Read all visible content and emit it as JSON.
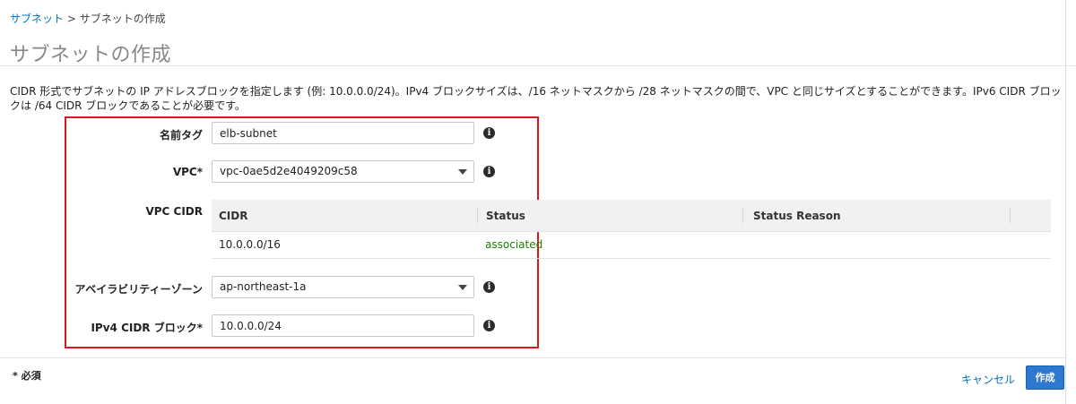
{
  "breadcrumb": {
    "parent": "サブネット",
    "separator": " > ",
    "current": "サブネットの作成"
  },
  "page_title": "サブネットの作成",
  "description": "CIDR 形式でサブネットの IP アドレスブロックを指定します (例: 10.0.0.0/24)。IPv4 ブロックサイズは、/16 ネットマスクから /28 ネットマスクの間で、VPC と同じサイズとすることができます。IPv6 CIDR ブロックは /64 CIDR ブロックであることが必要です。",
  "form": {
    "name_tag": {
      "label": "名前タグ",
      "value": "elb-subnet"
    },
    "vpc": {
      "label": "VPC*",
      "value": "vpc-0ae5d2e4049209c58"
    },
    "vpc_cidr": {
      "label": "VPC CIDR",
      "columns": [
        "CIDR",
        "Status",
        "Status Reason"
      ],
      "rows": [
        {
          "cidr": "10.0.0.0/16",
          "status": "associated",
          "reason": ""
        }
      ]
    },
    "availability_zone": {
      "label": "アベイラビリティーゾーン",
      "value": "ap-northeast-1a"
    },
    "ipv4_cidr": {
      "label": "IPv4 CIDR ブロック*",
      "value": "10.0.0.0/24"
    }
  },
  "footer": {
    "required_note": "* 必須",
    "cancel_label": "キャンセル",
    "create_label": "作成"
  },
  "colors": {
    "link": "#0073bb",
    "primary_button": "#2f78d1",
    "highlight_box": "#e0161e",
    "status_ok": "#1d8102"
  },
  "icons": {
    "info": "info-icon",
    "dropdown": "chevron-down-icon"
  }
}
